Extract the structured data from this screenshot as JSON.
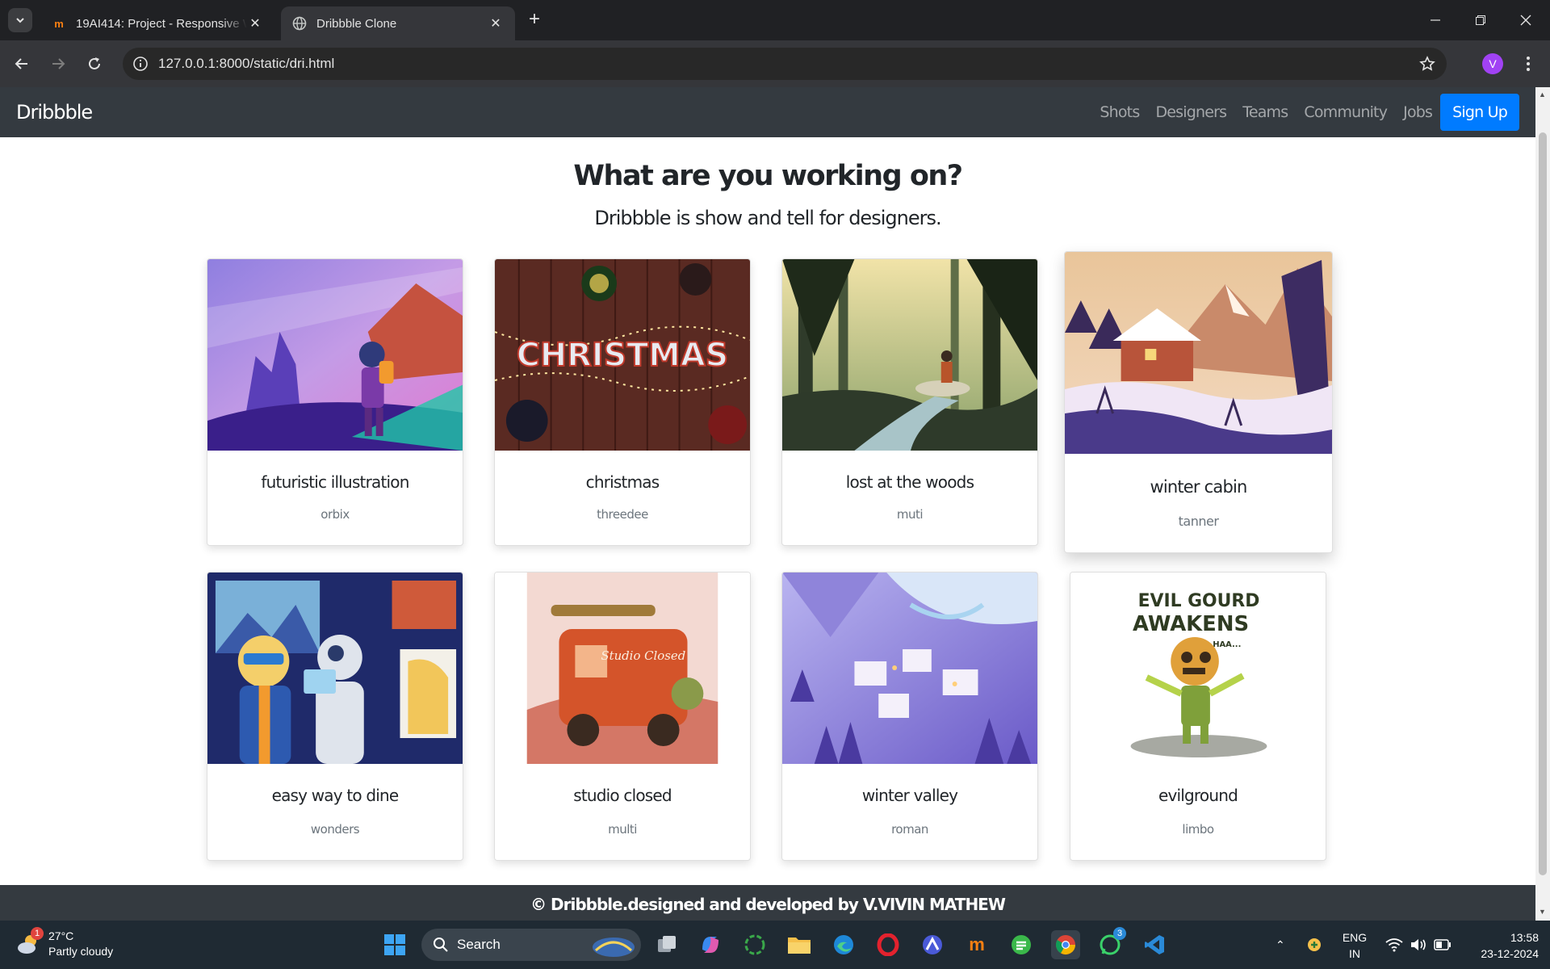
{
  "browser": {
    "tabs": [
      {
        "title": "19AI414: Project - Responsive Web",
        "favicon": "moodle-icon",
        "active": false
      },
      {
        "title": "Dribbble Clone",
        "favicon": "globe-icon",
        "active": true
      }
    ],
    "url": "127.0.0.1:8000/static/dri.html",
    "profile_initial": "V"
  },
  "site": {
    "brand": "Dribbble",
    "nav": [
      "Shots",
      "Designers",
      "Teams",
      "Community",
      "Jobs"
    ],
    "signup": "Sign Up",
    "hero_title": "What are you working on?",
    "hero_subtitle": "Dribbble is show and tell for designers.",
    "cards": [
      {
        "title": "futuristic illustration",
        "author": "orbix"
      },
      {
        "title": "christmas",
        "author": "threedee"
      },
      {
        "title": "lost at the woods",
        "author": "muti"
      },
      {
        "title": "winter cabin",
        "author": "tanner"
      },
      {
        "title": "easy way to dine",
        "author": "wonders"
      },
      {
        "title": "studio closed",
        "author": "multi"
      },
      {
        "title": "winter valley",
        "author": "roman"
      },
      {
        "title": "evilground",
        "author": "limbo"
      }
    ],
    "christmas_lettering": "CHRISTMAS",
    "studio_lettering": "Studio Closed",
    "evil_lettering": [
      "EVIL GOURD",
      "AWAKENS",
      "HAA..."
    ],
    "footer": "© Dribbble.designed and developed by V.VIVIN MATHEW"
  },
  "taskbar": {
    "weather_temp": "27°C",
    "weather_desc": "Partly cloudy",
    "weather_badge": "1",
    "search": "Search",
    "whatsapp_badge": "3",
    "lang_line1": "ENG",
    "lang_line2": "IN",
    "time": "13:58",
    "date": "23-12-2024"
  },
  "colors": {
    "navbar": "#343a40",
    "signup": "#007bff",
    "author_text": "#6c757d",
    "browser_frame": "#202124",
    "taskbar": "#1f2a33"
  }
}
